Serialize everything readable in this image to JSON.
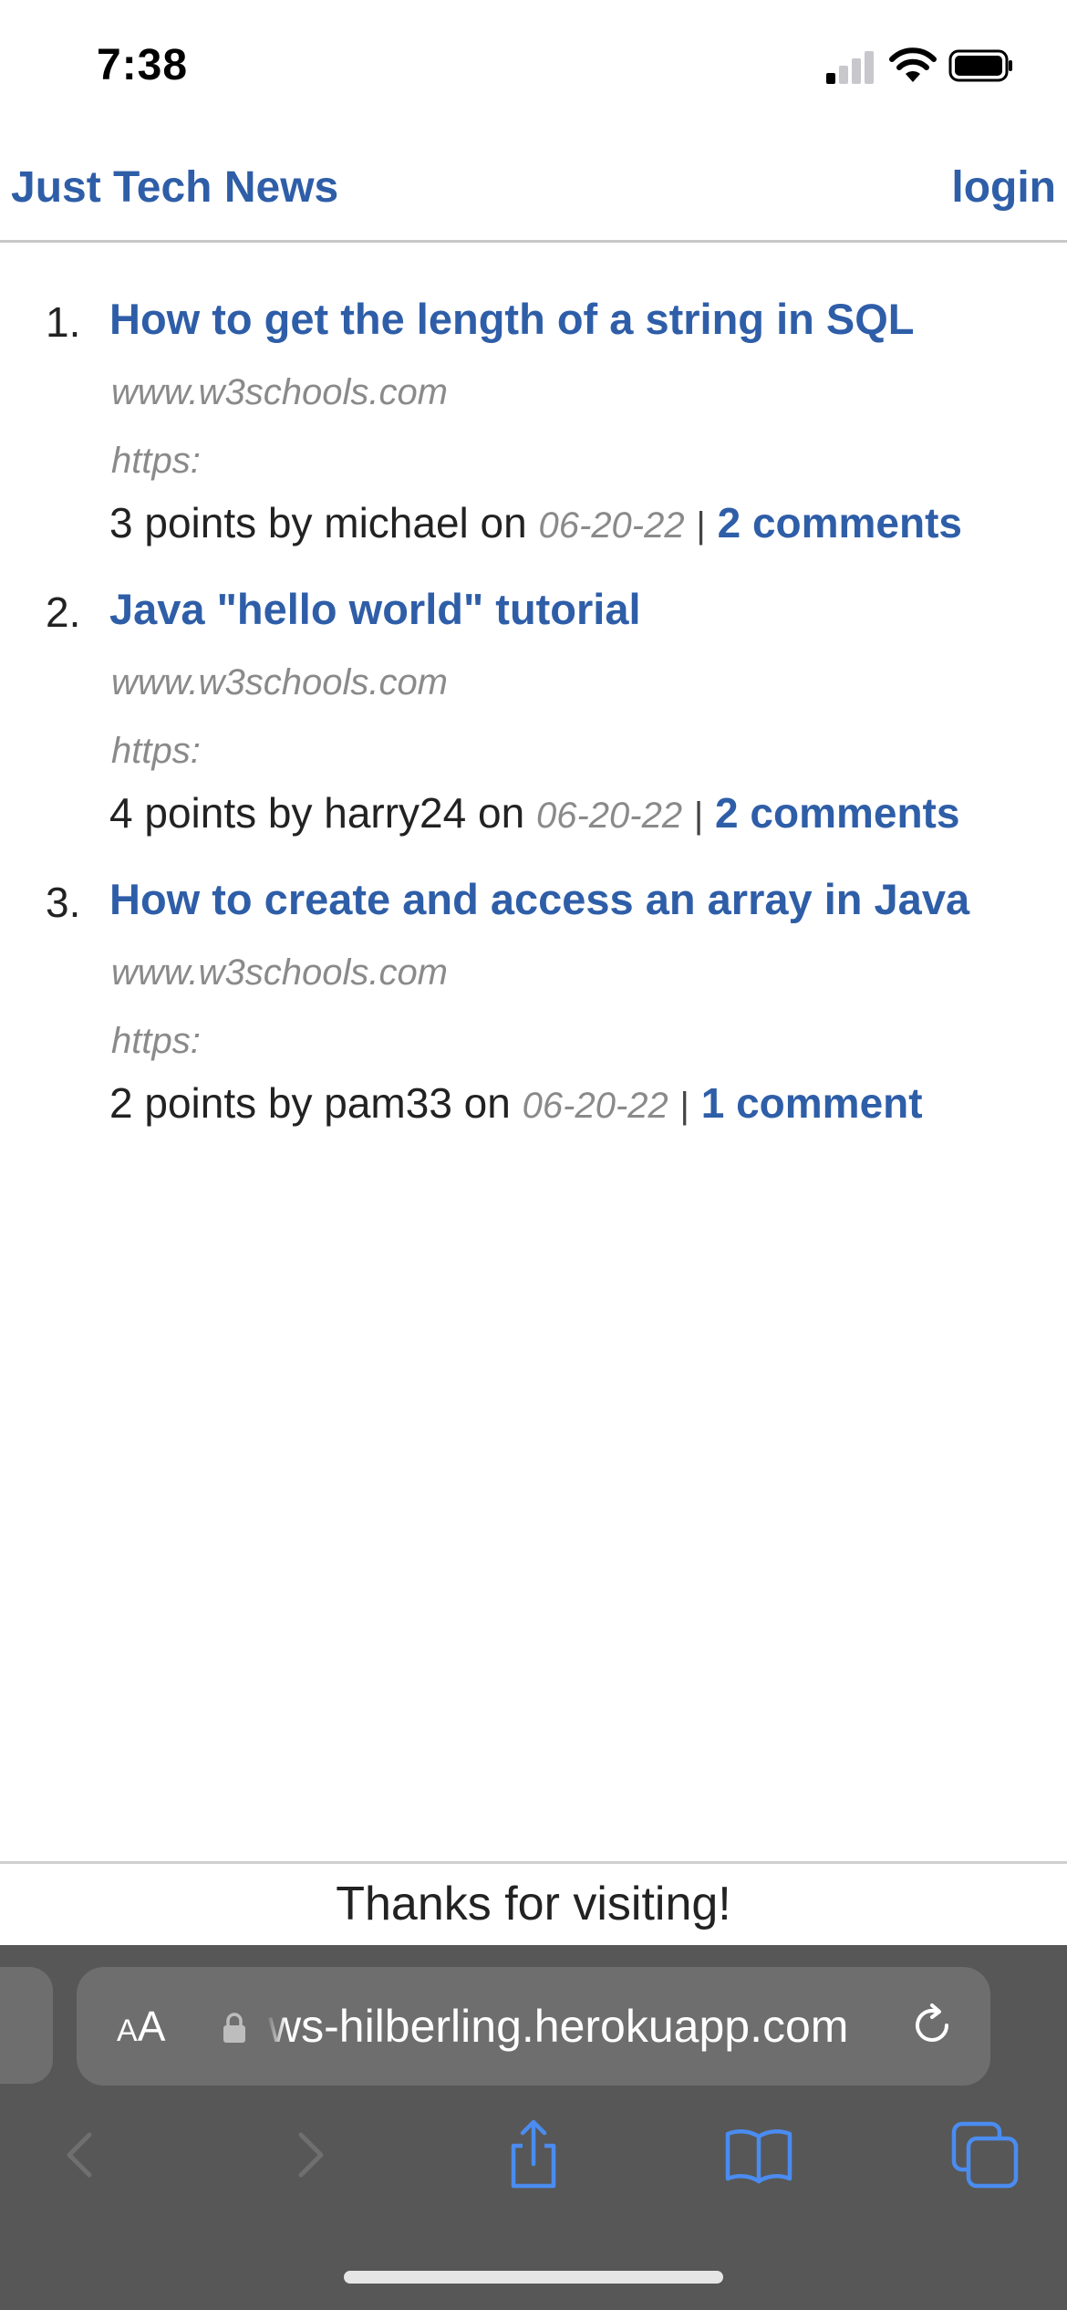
{
  "status_bar": {
    "time": "7:38",
    "signal_icon": "cellular-signal-icon",
    "wifi_icon": "wifi-icon",
    "battery_icon": "battery-icon"
  },
  "header": {
    "site_title": "Just Tech News",
    "login_label": "login"
  },
  "posts": [
    {
      "number": "1.",
      "title": "How to get the length of a string in SQL",
      "domain": "www.w3schools.com",
      "scheme": "https:",
      "points_text": "3 points by michael on",
      "date": "06-20-22",
      "separator": "|",
      "comments": "2 comments"
    },
    {
      "number": "2.",
      "title": "Java \"hello world\" tutorial",
      "domain": "www.w3schools.com",
      "scheme": "https:",
      "points_text": "4 points by harry24 on",
      "date": "06-20-22",
      "separator": "|",
      "comments": "2 comments"
    },
    {
      "number": "3.",
      "title": "How to create and access an array in Java",
      "domain": "www.w3schools.com",
      "scheme": "https:",
      "points_text": "2 points by pam33 on",
      "date": "06-20-22",
      "separator": "|",
      "comments": "1 comment"
    }
  ],
  "footer": {
    "text": "Thanks for visiting!"
  },
  "browser": {
    "aa_small": "A",
    "aa_large": "A",
    "url": "ws-hilberling.herokuapp.com",
    "icons": [
      "lock-icon",
      "reload-icon",
      "back-icon",
      "forward-icon",
      "share-icon",
      "bookmarks-icon",
      "tabs-icon"
    ]
  },
  "colors": {
    "link": "#2f5ea8",
    "muted": "#8a8a8a",
    "toolbar_bg": "#575757",
    "toolbar_control": "#6e6e6e",
    "toolbar_icon_active": "#4a8cf0",
    "toolbar_icon_disabled": "#6f6f6f"
  }
}
